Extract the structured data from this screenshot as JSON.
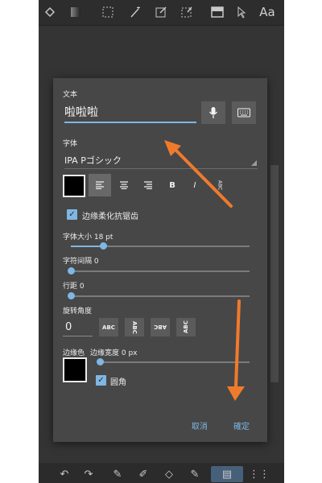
{
  "toolbar": {
    "top_icons": [
      "paint-bucket-icon",
      "gradient-icon",
      "rect-select-icon",
      "magic-wand-icon",
      "transform-icon",
      "lasso-icon",
      "layer-icon",
      "pointer-icon"
    ],
    "text_tool_label": "Aa",
    "bottom_icons": [
      "undo-icon",
      "redo-icon",
      "pen-icon",
      "brush-icon",
      "eraser-icon",
      "edit-icon",
      "layers-button-icon",
      "grid-icon"
    ]
  },
  "dialog": {
    "text_label": "文本",
    "text_value": "啦啦啦",
    "font_label": "字体",
    "font_value": "IPA Pゴシック",
    "format_buttons": {
      "align_left": "≡",
      "align_center": "≡",
      "align_right": "≡",
      "bold": "B",
      "italic": "I",
      "vertical": "ABC"
    },
    "antialias_label": "边缘柔化抗锯齿",
    "font_size_label": "字体大小 18 pt",
    "font_size_value": 18,
    "letter_spacing_label": "字符间隔 0",
    "letter_spacing_value": 0,
    "line_spacing_label": "行距 0",
    "line_spacing_value": 0,
    "rotation_label": "旋转角度",
    "rotation_value": "0",
    "rotation_buttons": [
      "ABC",
      "ABC",
      "ABC",
      "ABC"
    ],
    "border_color_label": "边缘色",
    "border_width_label": "边缘宽度 0 px",
    "border_width_value": 0,
    "rounded_label": "圆角",
    "cancel_label": "取消",
    "confirm_label": "確定"
  },
  "colors": {
    "accent": "#7fb6e3",
    "dialog_bg": "#474747",
    "annotation_arrow": "#f07a2c"
  }
}
